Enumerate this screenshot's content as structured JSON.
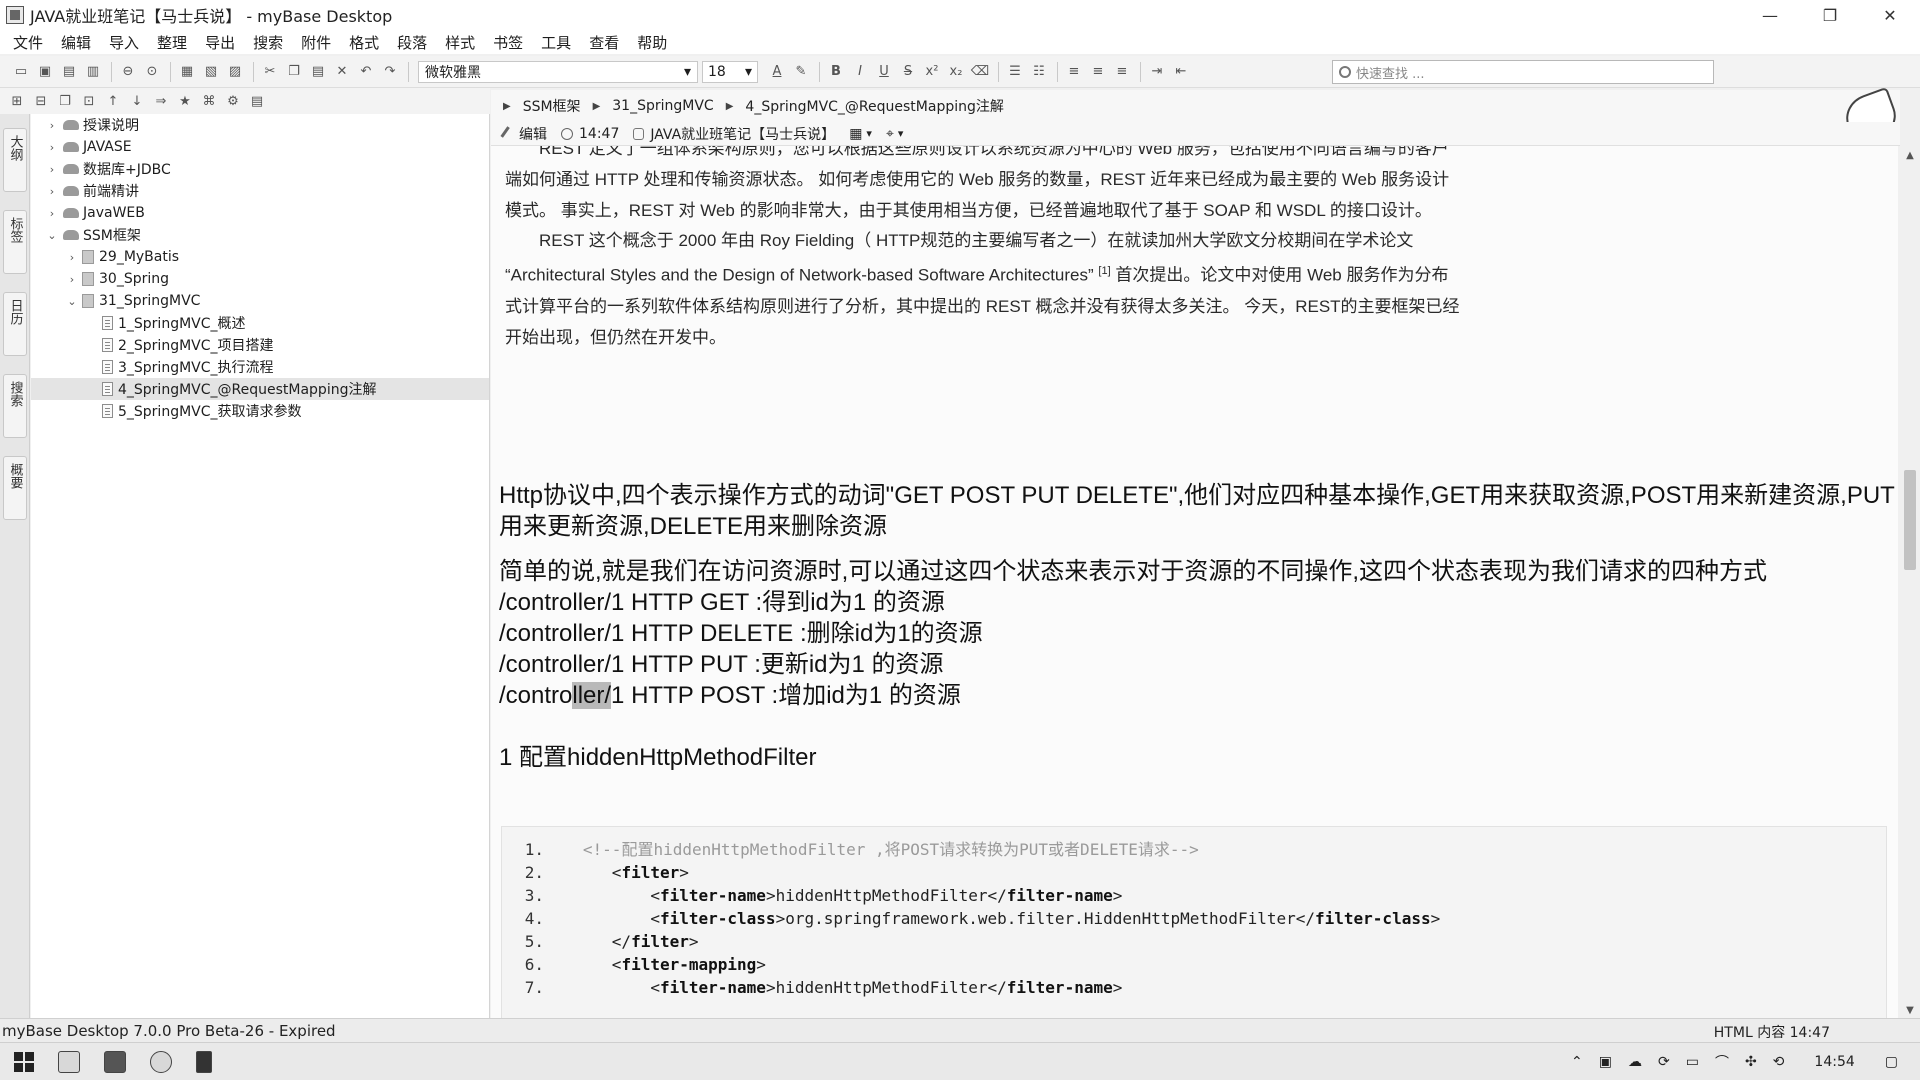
{
  "window": {
    "title": "JAVA就业班笔记【马士兵说】 - myBase Desktop",
    "minimize": "—",
    "maximize": "❐",
    "close": "✕"
  },
  "menu": [
    "文件",
    "编辑",
    "导入",
    "整理",
    "导出",
    "搜索",
    "附件",
    "格式",
    "段落",
    "样式",
    "书签",
    "工具",
    "查看",
    "帮助"
  ],
  "toolbar": {
    "font_name": "微软雅黑",
    "font_size": "18",
    "search_placeholder": "快速查找 ..."
  },
  "side_tabs": [
    "大纲",
    "标签",
    "日历",
    "搜索",
    "概要"
  ],
  "tree": [
    {
      "label": "授课说明",
      "level": 0,
      "expander": "›",
      "icon": "folder"
    },
    {
      "label": "JAVASE",
      "level": 0,
      "expander": "›",
      "icon": "folder"
    },
    {
      "label": "数据库+JDBC",
      "level": 0,
      "expander": "›",
      "icon": "folder"
    },
    {
      "label": "前端精讲",
      "level": 0,
      "expander": "›",
      "icon": "folder"
    },
    {
      "label": "JavaWEB",
      "level": 0,
      "expander": "›",
      "icon": "folder"
    },
    {
      "label": "SSM框架",
      "level": 0,
      "expander": "⌄",
      "icon": "folder"
    },
    {
      "label": "29_MyBatis",
      "level": 1,
      "expander": "›",
      "icon": "book"
    },
    {
      "label": "30_Spring",
      "level": 1,
      "expander": "›",
      "icon": "book"
    },
    {
      "label": "31_SpringMVC",
      "level": 1,
      "expander": "⌄",
      "icon": "book"
    },
    {
      "label": "1_SpringMVC_概述",
      "level": 2,
      "expander": "",
      "icon": "doc"
    },
    {
      "label": "2_SpringMVC_项目搭建",
      "level": 2,
      "expander": "",
      "icon": "doc"
    },
    {
      "label": "3_SpringMVC_执行流程",
      "level": 2,
      "expander": "",
      "icon": "doc"
    },
    {
      "label": "4_SpringMVC_@RequestMapping注解",
      "level": 2,
      "expander": "",
      "icon": "doc",
      "selected": true
    },
    {
      "label": "5_SpringMVC_获取请求参数",
      "level": 2,
      "expander": "",
      "icon": "doc"
    }
  ],
  "breadcrumb": [
    "SSM框架",
    "31_SpringMVC",
    "4_SpringMVC_@RequestMapping注解"
  ],
  "info": {
    "edit_label": "编辑",
    "time": "14:47",
    "database": "JAVA就业班笔记【马士兵说】"
  },
  "document": {
    "para1": [
      "REST 定义了一组体系架构原则，您可以根据这些原则设计以系统资源为中心的 Web 服务，包括使用不同语言编写的客户",
      "端如何通过 HTTP 处理和传输资源状态。 如何考虑使用它的 Web 服务的数量，REST 近年来已经成为最主要的 Web 服务设计",
      "模式。 事实上，REST 对 Web 的影响非常大，由于其使用相当方便，已经普遍地取代了基于 SOAP 和 WSDL 的接口设计。"
    ],
    "para2_line1": "REST 这个概念于 2000 年由 Roy Fielding（ HTTP规范的主要编写者之一）在就读加州大学欧文分校期间在学术论文",
    "para2_line2_text": "“Architectural Styles and the Design of Network-based Software Architectures”",
    "para2_line2_ref": "[1]",
    "para2_line2_rest": " 首次提出。论文中对使用 Web 服务作为分布",
    "para2_line3": "式计算平台的一系列软件体系结构原则进行了分析，其中提出的 REST 概念并没有获得太多关注。 今天，REST的主要框架已经",
    "para2_line4": "开始出现，但仍然在开发中。",
    "http_line1": "Http协议中,四个表示操作方式的动词\"GET POST PUT DELETE\",他们对应四种基本操作,GET用来获取资源,POST用来新建资源,PUT",
    "http_line2": "用来更新资源,DELETE用来删除资源",
    "simple": "简单的说,就是我们在访问资源时,可以通过这四个状态来表示对于资源的不同操作,这四个状态表现为我们请求的四种方式",
    "routes": [
      "/controller/1  HTTP GET :得到id为1 的资源",
      "/controller/1  HTTP DELETE :删除id为1的资源",
      "/controller/1  HTTP PUT :更新id为1 的资源"
    ],
    "route4_pre": "/contro",
    "route4_sel": "ller/",
    "route4_post": "1  HTTP POST :增加id为1 的资源",
    "section_heading": "1 配置hiddenHttpMethodFilter"
  },
  "code": [
    {
      "n": "1.",
      "indent": "   ",
      "parts": [
        {
          "t": "<!--配置hiddenHttpMethodFilter ,将POST请求转换为PUT或者DELETE请求-->",
          "c": "cm"
        }
      ]
    },
    {
      "n": "2.",
      "indent": "      ",
      "parts": [
        {
          "t": "<",
          "c": ""
        },
        {
          "t": "filter",
          "c": "tag"
        },
        {
          "t": ">",
          "c": ""
        }
      ]
    },
    {
      "n": "3.",
      "indent": "          ",
      "parts": [
        {
          "t": "<",
          "c": ""
        },
        {
          "t": "filter-name",
          "c": "tag"
        },
        {
          "t": ">hiddenHttpMethodFilter</",
          "c": ""
        },
        {
          "t": "filter-name",
          "c": "tag"
        },
        {
          "t": ">",
          "c": ""
        }
      ]
    },
    {
      "n": "4.",
      "indent": "          ",
      "parts": [
        {
          "t": "<",
          "c": ""
        },
        {
          "t": "filter-class",
          "c": "tag"
        },
        {
          "t": ">org.springframework.web.filter.HiddenHttpMethodFilter</",
          "c": ""
        },
        {
          "t": "filter-class",
          "c": "tag"
        },
        {
          "t": ">",
          "c": ""
        }
      ]
    },
    {
      "n": "5.",
      "indent": "      ",
      "parts": [
        {
          "t": "</",
          "c": ""
        },
        {
          "t": "filter",
          "c": "tag"
        },
        {
          "t": ">",
          "c": ""
        }
      ]
    },
    {
      "n": "6.",
      "indent": "      ",
      "parts": [
        {
          "t": "<",
          "c": ""
        },
        {
          "t": "filter-mapping",
          "c": "tag"
        },
        {
          "t": ">",
          "c": ""
        }
      ]
    },
    {
      "n": "7.",
      "indent": "          ",
      "parts": [
        {
          "t": "<",
          "c": ""
        },
        {
          "t": "filter-name",
          "c": "tag"
        },
        {
          "t": ">hiddenHttpMethodFilter</",
          "c": ""
        },
        {
          "t": "filter-name",
          "c": "tag"
        },
        {
          "t": ">",
          "c": ""
        }
      ]
    }
  ],
  "status": {
    "left": "myBase Desktop 7.0.0 Pro Beta-26 - Expired",
    "right": "HTML 内容 14:47"
  },
  "taskbar": {
    "clock": "14:54"
  }
}
